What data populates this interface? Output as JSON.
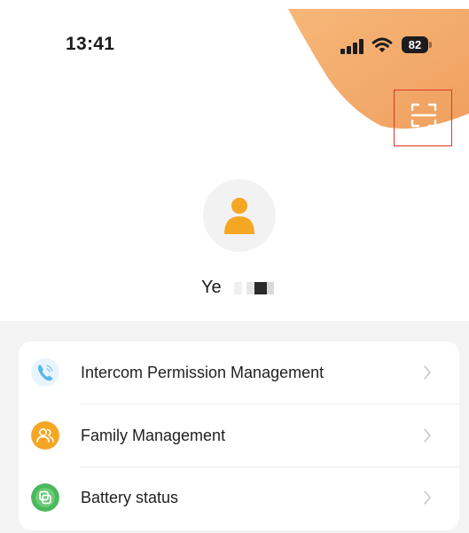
{
  "status_bar": {
    "time": "13:41",
    "battery_level": "82",
    "icons": [
      "cellular-signal-icon",
      "wifi-icon",
      "battery-icon"
    ]
  },
  "header": {
    "scan_button_icon": "scan-icon",
    "accent_color": "#F2A766",
    "highlight_color": "#E2352A"
  },
  "profile": {
    "avatar_icon": "user-avatar-icon",
    "name": "Ye"
  },
  "menu": {
    "items": [
      {
        "label": "Intercom Permission Management",
        "icon": "intercom-phone-icon",
        "icon_color": "#5BB8E8"
      },
      {
        "label": "Family Management",
        "icon": "family-icon",
        "icon_color": "#F5A623"
      },
      {
        "label": "Battery status",
        "icon": "battery-status-icon",
        "icon_color": "#4CB85C"
      }
    ],
    "chevron_icon": "chevron-right-icon"
  }
}
